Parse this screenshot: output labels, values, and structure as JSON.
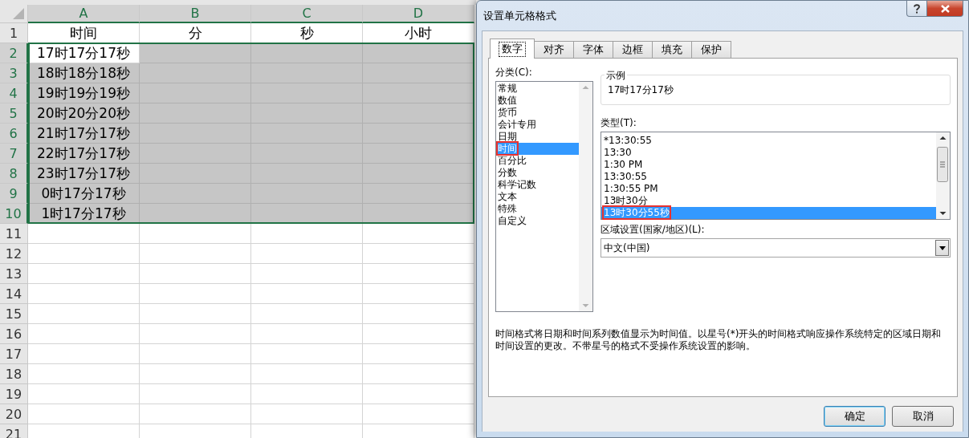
{
  "sheet": {
    "columns": [
      {
        "label": "A",
        "selected": true
      },
      {
        "label": "B",
        "selected": true
      },
      {
        "label": "C",
        "selected": true
      },
      {
        "label": "D",
        "selected": true
      }
    ],
    "rows": [
      {
        "number": "1",
        "selected": false,
        "cells": [
          {
            "text": "时间",
            "selected": false
          },
          {
            "text": "分",
            "selected": false
          },
          {
            "text": "秒",
            "selected": false
          },
          {
            "text": "小时",
            "selected": false
          }
        ]
      },
      {
        "number": "2",
        "selected": true,
        "cells": [
          {
            "text": "17时17分17秒",
            "selected": false
          },
          {
            "selected": true
          },
          {
            "selected": true
          },
          {
            "selected": true
          }
        ]
      },
      {
        "number": "3",
        "selected": true,
        "cells": [
          {
            "text": "18时18分18秒",
            "selected": true
          },
          {
            "selected": true
          },
          {
            "selected": true
          },
          {
            "selected": true
          }
        ]
      },
      {
        "number": "4",
        "selected": true,
        "cells": [
          {
            "text": "19时19分19秒",
            "selected": true
          },
          {
            "selected": true
          },
          {
            "selected": true
          },
          {
            "selected": true
          }
        ]
      },
      {
        "number": "5",
        "selected": true,
        "cells": [
          {
            "text": "20时20分20秒",
            "selected": true
          },
          {
            "selected": true
          },
          {
            "selected": true
          },
          {
            "selected": true
          }
        ]
      },
      {
        "number": "6",
        "selected": true,
        "cells": [
          {
            "text": "21时17分17秒",
            "selected": true
          },
          {
            "selected": true
          },
          {
            "selected": true
          },
          {
            "selected": true
          }
        ]
      },
      {
        "number": "7",
        "selected": true,
        "cells": [
          {
            "text": "22时17分17秒",
            "selected": true
          },
          {
            "selected": true
          },
          {
            "selected": true
          },
          {
            "selected": true
          }
        ]
      },
      {
        "number": "8",
        "selected": true,
        "cells": [
          {
            "text": "23时17分17秒",
            "selected": true
          },
          {
            "selected": true
          },
          {
            "selected": true
          },
          {
            "selected": true
          }
        ]
      },
      {
        "number": "9",
        "selected": true,
        "cells": [
          {
            "text": "0时17分17秒",
            "selected": true
          },
          {
            "selected": true
          },
          {
            "selected": true
          },
          {
            "selected": true
          }
        ]
      },
      {
        "number": "10",
        "selected": true,
        "cells": [
          {
            "text": "1时17分17秒",
            "selected": true
          },
          {
            "selected": true
          },
          {
            "selected": true
          },
          {
            "selected": true
          }
        ]
      },
      {
        "number": "11",
        "selected": false,
        "cells": [
          {
            "selected": false
          },
          {
            "selected": false
          },
          {
            "selected": false
          },
          {
            "selected": false
          }
        ]
      },
      {
        "number": "12",
        "selected": false,
        "cells": [
          {
            "selected": false
          },
          {
            "selected": false
          },
          {
            "selected": false
          },
          {
            "selected": false
          }
        ]
      },
      {
        "number": "13",
        "selected": false,
        "cells": [
          {
            "selected": false
          },
          {
            "selected": false
          },
          {
            "selected": false
          },
          {
            "selected": false
          }
        ]
      },
      {
        "number": "14",
        "selected": false,
        "cells": [
          {
            "selected": false
          },
          {
            "selected": false
          },
          {
            "selected": false
          },
          {
            "selected": false
          }
        ]
      },
      {
        "number": "15",
        "selected": false,
        "cells": [
          {
            "selected": false
          },
          {
            "selected": false
          },
          {
            "selected": false
          },
          {
            "selected": false
          }
        ]
      },
      {
        "number": "16",
        "selected": false,
        "cells": [
          {
            "selected": false
          },
          {
            "selected": false
          },
          {
            "selected": false
          },
          {
            "selected": false
          }
        ]
      },
      {
        "number": "17",
        "selected": false,
        "cells": [
          {
            "selected": false
          },
          {
            "selected": false
          },
          {
            "selected": false
          },
          {
            "selected": false
          }
        ]
      },
      {
        "number": "18",
        "selected": false,
        "cells": [
          {
            "selected": false
          },
          {
            "selected": false
          },
          {
            "selected": false
          },
          {
            "selected": false
          }
        ]
      },
      {
        "number": "19",
        "selected": false,
        "cells": [
          {
            "selected": false
          },
          {
            "selected": false
          },
          {
            "selected": false
          },
          {
            "selected": false
          }
        ]
      },
      {
        "number": "20",
        "selected": false,
        "cells": [
          {
            "selected": false
          },
          {
            "selected": false
          },
          {
            "selected": false
          },
          {
            "selected": false
          }
        ]
      },
      {
        "number": "21",
        "selected": false,
        "cells": [
          {
            "selected": false
          },
          {
            "selected": false
          },
          {
            "selected": false
          },
          {
            "selected": false
          }
        ]
      }
    ]
  },
  "dialog": {
    "title": "设置单元格格式",
    "tabs": [
      {
        "label": "数字",
        "selected": true
      },
      {
        "label": "对齐",
        "selected": false
      },
      {
        "label": "字体",
        "selected": false
      },
      {
        "label": "边框",
        "selected": false
      },
      {
        "label": "填充",
        "selected": false
      },
      {
        "label": "保护",
        "selected": false
      }
    ],
    "category_label": "分类(C):",
    "categories": [
      {
        "label": "常规",
        "selected": false,
        "highlighted": false
      },
      {
        "label": "数值",
        "selected": false,
        "highlighted": false
      },
      {
        "label": "货币",
        "selected": false,
        "highlighted": false
      },
      {
        "label": "会计专用",
        "selected": false,
        "highlighted": false
      },
      {
        "label": "日期",
        "selected": false,
        "highlighted": false
      },
      {
        "label": "时间",
        "selected": true,
        "highlighted": true
      },
      {
        "label": "百分比",
        "selected": false,
        "highlighted": false
      },
      {
        "label": "分数",
        "selected": false,
        "highlighted": false
      },
      {
        "label": "科学记数",
        "selected": false,
        "highlighted": false
      },
      {
        "label": "文本",
        "selected": false,
        "highlighted": false
      },
      {
        "label": "特殊",
        "selected": false,
        "highlighted": false
      },
      {
        "label": "自定义",
        "selected": false,
        "highlighted": false
      }
    ],
    "sample_label": "示例",
    "sample_value": "17时17分17秒",
    "type_label": "类型(T):",
    "types": [
      {
        "label": "*13:30:55",
        "selected": false,
        "highlighted": false
      },
      {
        "label": "13:30",
        "selected": false,
        "highlighted": false
      },
      {
        "label": "1:30 PM",
        "selected": false,
        "highlighted": false
      },
      {
        "label": "13:30:55",
        "selected": false,
        "highlighted": false
      },
      {
        "label": "1:30:55 PM",
        "selected": false,
        "highlighted": false
      },
      {
        "label": "13时30分",
        "selected": false,
        "highlighted": false
      },
      {
        "label": "13时30分55秒",
        "selected": true,
        "highlighted": true
      }
    ],
    "locale_label": "区域设置(国家/地区)(L):",
    "locale_value": "中文(中国)",
    "description": "时间格式将日期和时间系列数值显示为时间值。以星号(*)开头的时间格式响应操作系统特定的区域日期和时间设置的更改。不带星号的格式不受操作系统设置的影响。",
    "buttons": [
      {
        "label": "确定",
        "default": true
      },
      {
        "label": "取消",
        "default": false
      }
    ]
  }
}
